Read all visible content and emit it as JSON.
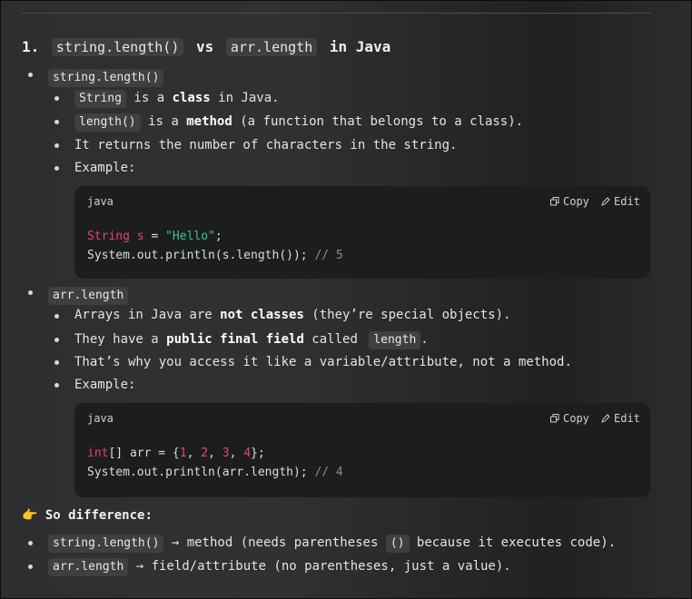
{
  "heading": {
    "number": "1.",
    "code_a": "string.length()",
    "vs": "vs",
    "code_b": "arr.length",
    "suffix": "in Java"
  },
  "section1": {
    "label": "string.length()",
    "items": [
      {
        "code": "String",
        "pre": "is a ",
        "bold": "class",
        "post": " in Java."
      },
      {
        "code": "length()",
        "pre": "is a ",
        "bold": "method",
        "post": " (a function that belongs to a class)."
      },
      {
        "text": "It returns the number of characters in the string."
      },
      {
        "text": "Example:"
      }
    ],
    "block": {
      "lang": "java",
      "copy": "Copy",
      "edit": "Edit",
      "line1": {
        "type": "String",
        "var": " s",
        "eq": " = ",
        "str": "\"Hello\"",
        "end": ";"
      },
      "line2": {
        "code": "System.out.println(s.length()); ",
        "comment": "// 5"
      }
    }
  },
  "section2": {
    "label": "arr.length",
    "items": [
      {
        "pre": "Arrays in Java are ",
        "bold": "not classes",
        "post": " (they’re special objects)."
      },
      {
        "pre": "They have a ",
        "bold": "public final field",
        "mid": " called ",
        "code": "length",
        "post": "."
      },
      {
        "text": "That’s why you access it like a variable/attribute, not a method."
      },
      {
        "text": "Example:"
      }
    ],
    "block": {
      "lang": "java",
      "copy": "Copy",
      "edit": "Edit",
      "line1": {
        "kw": "int",
        "a": "[] arr = {",
        "n1": "1",
        "c1": ", ",
        "n2": "2",
        "c2": ", ",
        "n3": "3",
        "c3": ", ",
        "n4": "4",
        "end": "};"
      },
      "line2": {
        "code": "System.out.println(arr.length); ",
        "comment": "// 4"
      }
    }
  },
  "summary": {
    "emoji": "👉",
    "title": "So difference:",
    "items": [
      {
        "code": "string.length()",
        "pre": " → method (needs parentheses ",
        "code2": "()",
        "post": " because it executes code)."
      },
      {
        "code": "arr.length",
        "pre": " → field/attribute (no parentheses, just a value)."
      }
    ]
  }
}
